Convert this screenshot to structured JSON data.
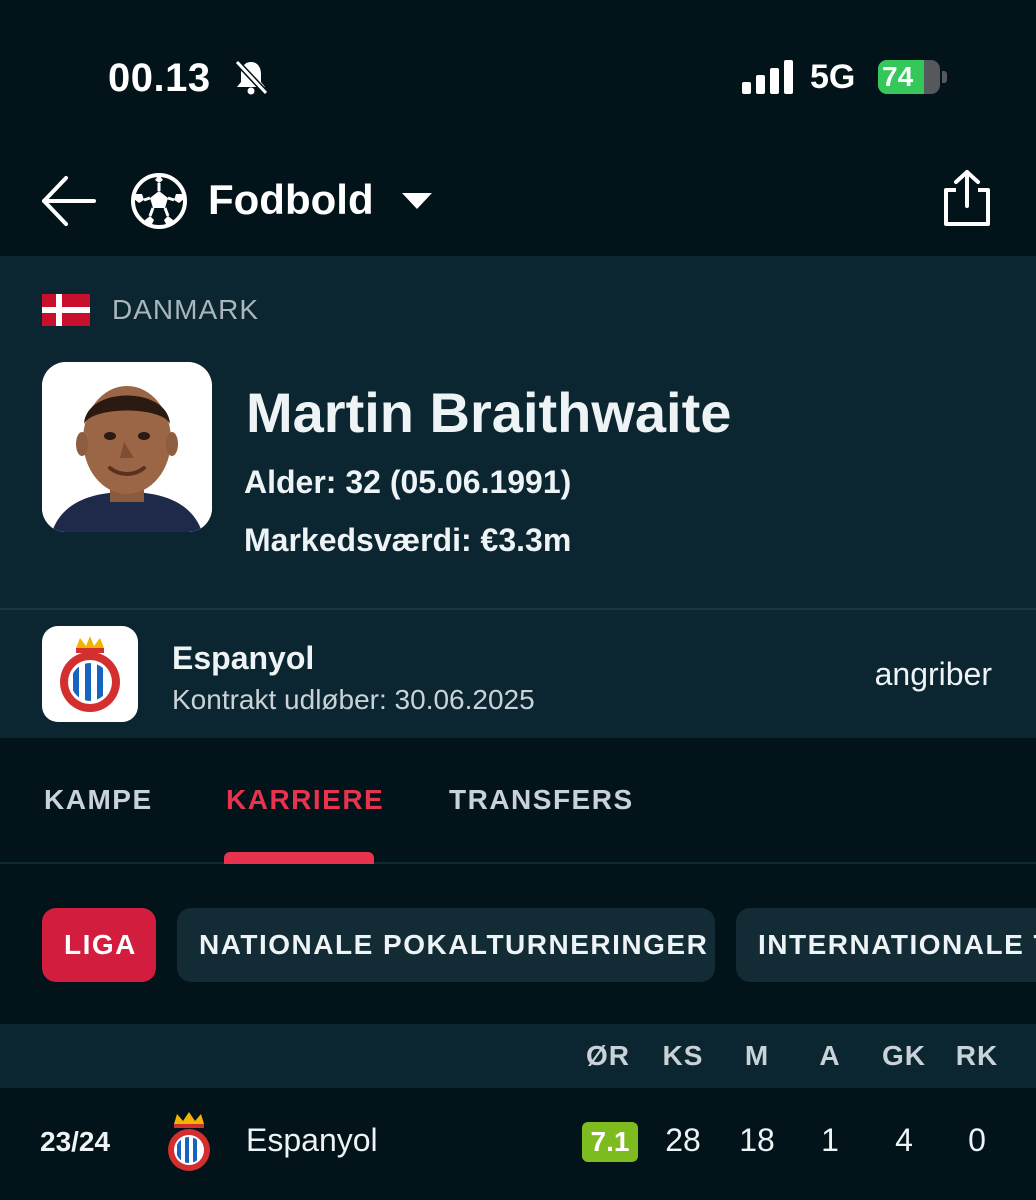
{
  "status_bar": {
    "time": "00.13",
    "network": "5G",
    "battery": "74",
    "battery_level": 0.74
  },
  "nav": {
    "title": "Fodbold"
  },
  "player": {
    "country": "DANMARK",
    "name": "Martin Braithwaite",
    "age": "Alder: 32 (05.06.1991)",
    "market_value": "Markedsværdi: €3.3m"
  },
  "club": {
    "name": "Espanyol",
    "contract": "Kontrakt udløber: 30.06.2025",
    "position": "angriber"
  },
  "tabs": [
    {
      "label": "KAMPE",
      "active": false
    },
    {
      "label": "KARRIERE",
      "active": true
    },
    {
      "label": "TRANSFERS",
      "active": false
    }
  ],
  "filters": [
    {
      "label": "LIGA",
      "active": true
    },
    {
      "label": "NATIONALE POKALTURNERINGER",
      "active": false
    },
    {
      "label": "INTERNATIONALE TURNERINGER",
      "active": false
    }
  ],
  "table": {
    "headers": [
      "ØR",
      "KS",
      "M",
      "A",
      "GK",
      "RK"
    ],
    "rows": [
      {
        "season": "23/24",
        "club": "Espanyol",
        "rating": "7.1",
        "ks": "28",
        "m": "18",
        "a": "1",
        "gk": "4",
        "rk": "0"
      }
    ]
  },
  "colors": {
    "accent": "#e8334f",
    "rating_green": "#7dbb1e",
    "background": "#03131a",
    "panel": "#0b2631"
  }
}
